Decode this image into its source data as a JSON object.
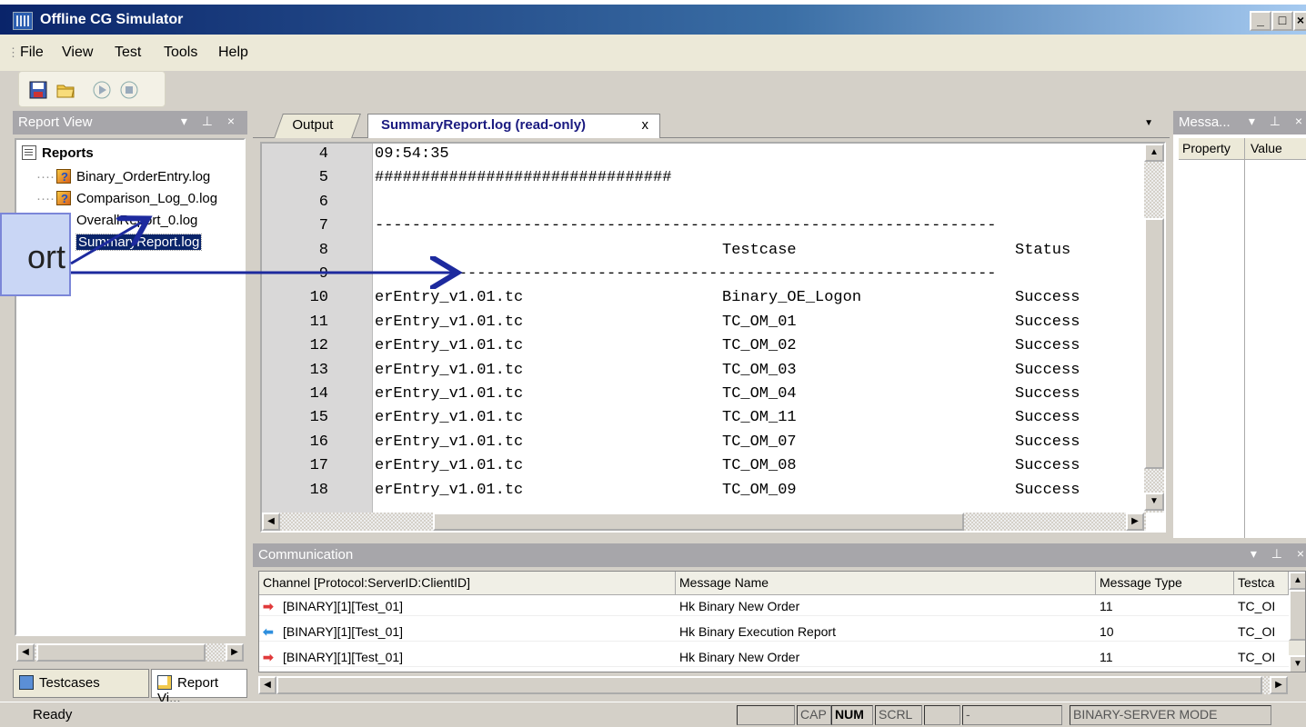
{
  "window": {
    "title": "Offline CG Simulator"
  },
  "menu": [
    "File",
    "View",
    "Test",
    "Tools",
    "Help"
  ],
  "report_view": {
    "header": "Report View",
    "root": "Reports",
    "items": [
      "Binary_OrderEntry.log",
      "Comparison_Log_0.log",
      "OverallReport_0.log",
      "SummaryReport.log"
    ],
    "tabs": [
      "Testcases",
      "Report Vi..."
    ]
  },
  "editor": {
    "tabs": {
      "output": "Output",
      "active": "SummaryReport.log (read-only)",
      "close": "x"
    },
    "lines": [
      {
        "n": "4",
        "a": "09:54:35",
        "b": "",
        "c": ""
      },
      {
        "n": "5",
        "a": "################################",
        "b": "",
        "c": ""
      },
      {
        "n": "6",
        "a": "",
        "b": "",
        "c": ""
      },
      {
        "n": "7",
        "a": "-------------------------------------------------------------------",
        "b": "",
        "c": ""
      },
      {
        "n": "8",
        "a": "",
        "b": "Testcase",
        "c": "Status"
      },
      {
        "n": "9",
        "a": "-------------------------------------------------------------------",
        "b": "",
        "c": ""
      },
      {
        "n": "10",
        "a": "erEntry_v1.01.tc",
        "b": "Binary_OE_Logon",
        "c": "Success"
      },
      {
        "n": "11",
        "a": "erEntry_v1.01.tc",
        "b": "TC_OM_01",
        "c": "Success"
      },
      {
        "n": "12",
        "a": "erEntry_v1.01.tc",
        "b": "TC_OM_02",
        "c": "Success"
      },
      {
        "n": "13",
        "a": "erEntry_v1.01.tc",
        "b": "TC_OM_03",
        "c": "Success"
      },
      {
        "n": "14",
        "a": "erEntry_v1.01.tc",
        "b": "TC_OM_04",
        "c": "Success"
      },
      {
        "n": "15",
        "a": "erEntry_v1.01.tc",
        "b": "TC_OM_11",
        "c": "Success"
      },
      {
        "n": "16",
        "a": "erEntry_v1.01.tc",
        "b": "TC_OM_07",
        "c": "Success"
      },
      {
        "n": "17",
        "a": "erEntry_v1.01.tc",
        "b": "TC_OM_08",
        "c": "Success"
      },
      {
        "n": "18",
        "a": "erEntry_v1.01.tc",
        "b": "TC_OM_09",
        "c": "Success"
      }
    ]
  },
  "messages_panel": {
    "header": "Messa...",
    "col_property": "Property",
    "col_value": "Value"
  },
  "communication": {
    "header": "Communication",
    "columns": [
      "Channel [Protocol:ServerID:ClientID]",
      "Message Name",
      "Message Type",
      "Testca"
    ],
    "rows": [
      {
        "dir": "out",
        "channel": "[BINARY][1][Test_01]",
        "name": "Hk Binary New Order",
        "type": "11",
        "tc": "TC_OI"
      },
      {
        "dir": "in",
        "channel": "[BINARY][1][Test_01]",
        "name": "Hk Binary Execution Report",
        "type": "10",
        "tc": "TC_OI"
      },
      {
        "dir": "out",
        "channel": "[BINARY][1][Test_01]",
        "name": "Hk Binary New Order",
        "type": "11",
        "tc": "TC_OI"
      }
    ]
  },
  "status": {
    "text": "Ready",
    "cap": "CAP",
    "num": "NUM",
    "scrl": "SCRL",
    "dash": "-",
    "mode": "BINARY-SERVER MODE"
  },
  "callout": {
    "text": "ort"
  }
}
